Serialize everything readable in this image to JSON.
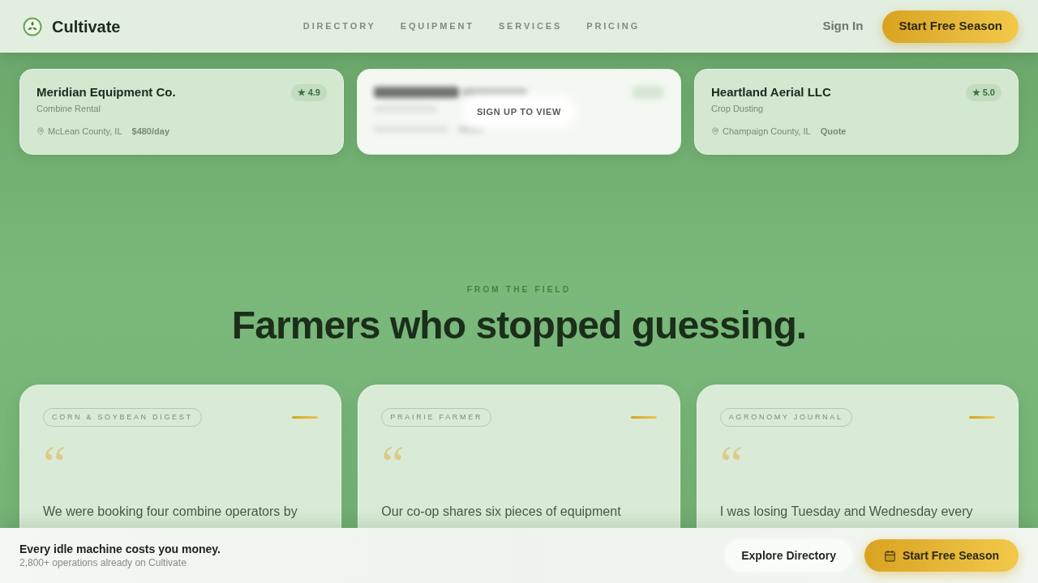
{
  "header": {
    "brand": "Cultivate",
    "nav": [
      {
        "label": "DIRECTORY"
      },
      {
        "label": "EQUIPMENT"
      },
      {
        "label": "SERVICES"
      },
      {
        "label": "PRICING"
      }
    ],
    "sign_in": "Sign In",
    "cta": "Start Free Season"
  },
  "listings": [
    {
      "locked": false,
      "name": "Meridian Equipment Co.",
      "category": "Combine Rental",
      "rating": "★ 4.9",
      "location": "McLean County, IL",
      "price": "$480/day"
    },
    {
      "locked": true,
      "overlay": "SIGN UP TO VIEW"
    },
    {
      "locked": false,
      "name": "Heartland Aerial LLC",
      "category": "Crop Dusting",
      "rating": "★ 5.0",
      "location": "Champaign County, IL",
      "price": "Quote"
    }
  ],
  "testimonials_section": {
    "eyebrow": "FROM THE FIELD",
    "heading": "Farmers who stopped guessing."
  },
  "testimonials": [
    {
      "source": "CORN & SOYBEAN DIGEST",
      "quote_mark": "“",
      "quote": "We were booking four combine operators by"
    },
    {
      "source": "PRAIRIE FARMER",
      "quote_mark": "“",
      "quote": "Our co-op shares six pieces of equipment"
    },
    {
      "source": "AGRONOMY JOURNAL",
      "quote_mark": "“",
      "quote": "I was losing Tuesday and Wednesday every"
    }
  ],
  "bottom_bar": {
    "headline": "Every idle machine costs you money.",
    "subtext": "2,800+ operations already on Cultivate",
    "secondary_button": "Explore Directory",
    "primary_button": "Start Free Season"
  }
}
